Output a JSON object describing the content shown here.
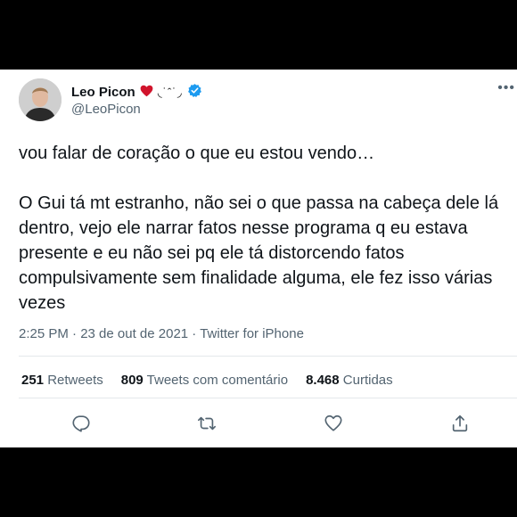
{
  "author": {
    "name": "Leo Picon",
    "emoji": "◟˙ˆ˙◞",
    "handle": "@LeoPicon"
  },
  "more_label": "•••",
  "tweet": {
    "text": "vou falar de coração o que eu estou vendo…\n\nO Gui tá mt estranho, não sei o que passa na cabeça dele lá dentro, vejo ele narrar fatos nesse programa q eu estava presente e eu não sei pq ele tá distorcendo fatos compulsivamente sem finalidade alguma, ele fez isso várias vezes",
    "meta": "2:25 PM · 23 de out de 2021 · Twitter for iPhone"
  },
  "stats": {
    "retweets_count": "251",
    "retweets_label": "Retweets",
    "quotes_count": "809",
    "quotes_label": "Tweets com comentário",
    "likes_count": "8.468",
    "likes_label": "Curtidas"
  },
  "colors": {
    "heart": "#d1142c",
    "verified": "#1d9bf0",
    "secondary_text": "#536471"
  },
  "icons": [
    "heart-emoji-icon",
    "verified-badge-icon",
    "more-icon",
    "reply-icon",
    "retweet-icon",
    "like-icon",
    "share-icon"
  ]
}
